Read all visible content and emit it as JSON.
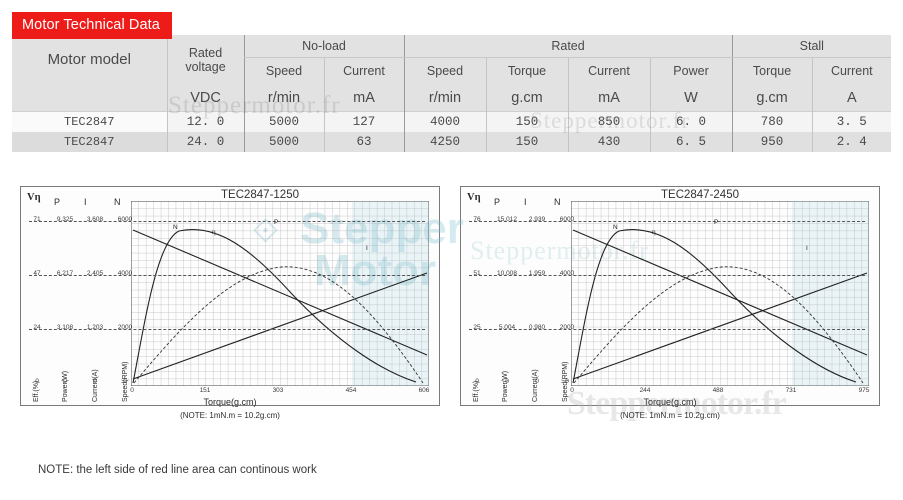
{
  "badge": {
    "label": "Motor Technical Data",
    "color": "#ee1c19"
  },
  "watermark": {
    "text": "Steppermotor.fr",
    "brand_line1": "Stepper",
    "brand_line2": "Motor",
    "logo_glyph": "⟐"
  },
  "table": {
    "model_header": "Motor model",
    "rated_voltage_header_line1": "Rated",
    "rated_voltage_header_line2": "voltage",
    "groups": [
      {
        "label": "No-load",
        "span": 2
      },
      {
        "label": "Rated",
        "span": 4
      },
      {
        "label": "Stall",
        "span": 2
      }
    ],
    "subheaders": [
      "Speed",
      "Current",
      "Speed",
      "Torque",
      "Current",
      "Power",
      "Torque",
      "Current"
    ],
    "units": [
      "VDC",
      "r/min",
      "mA",
      "r/min",
      "g.cm",
      "mA",
      "W",
      "g.cm",
      "A"
    ],
    "rows": [
      {
        "model": "TEC2847",
        "values": [
          "12. 0",
          "5000",
          "127",
          "4000",
          "150",
          "850",
          "6. 0",
          "780",
          "3. 5"
        ]
      },
      {
        "model": "TEC2847",
        "values": [
          "24. 0",
          "5000",
          "63",
          "4250",
          "150",
          "430",
          "6. 5",
          "950",
          "2. 4"
        ]
      }
    ]
  },
  "charts": [
    {
      "title": "TEC2847-1250",
      "axis_headers": [
        "Vη",
        "P",
        "I",
        "N"
      ],
      "vertical_axis_labels": [
        "Eff.(%)",
        "Power(W)",
        "Current(A)",
        "Speed(RPM)"
      ],
      "xaxis_title": "Torque(g.cm)",
      "xaxis_note": "(NOTE: 1mN.m = 10.2g.cm)",
      "curve_labels": [
        "N",
        "η",
        "P",
        "I"
      ],
      "gridrows": [
        {
          "eff": "71",
          "power": "9.325",
          "current": "3.608",
          "speed": "6000"
        },
        {
          "eff": "47",
          "power": "6.217",
          "current": "2.405",
          "speed": "4000"
        },
        {
          "eff": "24",
          "power": "3.108",
          "current": "1.203",
          "speed": "2000"
        },
        {
          "eff": "0",
          "power": "0",
          "current": "0",
          "speed": "0"
        }
      ],
      "xticks": [
        "0",
        "151",
        "303",
        "454",
        "606"
      ]
    },
    {
      "title": "TEC2847-2450",
      "axis_headers": [
        "Vη",
        "P",
        "I",
        "N"
      ],
      "vertical_axis_labels": [
        "Eff.(%)",
        "Power(W)",
        "Current(A)",
        "Speed(RPM)"
      ],
      "xaxis_title": "Torque(g.cm)",
      "xaxis_note": "(NOTE: 1mN.m = 10.2g.cm)",
      "curve_labels": [
        "N",
        "η",
        "P",
        "I"
      ],
      "gridrows": [
        {
          "eff": "76",
          "power": "15.012",
          "current": "2.939",
          "speed": "6000"
        },
        {
          "eff": "51",
          "power": "10.008",
          "current": "1.959",
          "speed": "4000"
        },
        {
          "eff": "25",
          "power": "5.004",
          "current": "0.980",
          "speed": "2000"
        },
        {
          "eff": "0",
          "power": "0",
          "current": "0",
          "speed": "0"
        }
      ],
      "xticks": [
        "0",
        "244",
        "488",
        "731",
        "975"
      ]
    }
  ],
  "footnote": "NOTE: the left side of red line area can continous work",
  "chart_data": [
    {
      "type": "line",
      "title": "TEC2847-1250",
      "xlabel": "Torque(g.cm)",
      "xlim": [
        0,
        680
      ],
      "xticks": [
        0,
        151,
        303,
        454,
        606
      ],
      "grid": true,
      "legend": "inline-curve-labels",
      "axes": [
        {
          "name": "Eff.(%)",
          "symbol": "Vη",
          "ticks": [
            0,
            24,
            47,
            71
          ]
        },
        {
          "name": "Power(W)",
          "symbol": "P",
          "ticks": [
            0,
            3.108,
            6.217,
            9.325
          ]
        },
        {
          "name": "Current(A)",
          "symbol": "I",
          "ticks": [
            0,
            1.203,
            2.405,
            3.608
          ]
        },
        {
          "name": "Speed(RPM)",
          "symbol": "N",
          "ticks": [
            0,
            2000,
            4000,
            6000
          ]
        }
      ],
      "series": [
        {
          "name": "N",
          "axis": "Speed(RPM)",
          "x": [
            0,
            151,
            303,
            454,
            606,
            680
          ],
          "values": [
            5000,
            4300,
            3450,
            2600,
            1750,
            1280
          ]
        },
        {
          "name": "I",
          "axis": "Current(A)",
          "x": [
            0,
            151,
            303,
            454,
            606,
            680
          ],
          "values": [
            0.127,
            0.85,
            1.62,
            2.38,
            3.15,
            3.55
          ]
        },
        {
          "name": "P",
          "axis": "Power(W)",
          "x": [
            0,
            151,
            303,
            454,
            606,
            680
          ],
          "values": [
            0,
            3.1,
            5.4,
            6.2,
            4.9,
            3.1
          ]
        },
        {
          "name": "η",
          "axis": "Eff.(%)",
          "x": [
            0,
            60,
            151,
            303,
            454,
            606,
            680
          ],
          "values": [
            0,
            48,
            55,
            47,
            32,
            14,
            4
          ]
        }
      ]
    },
    {
      "type": "line",
      "title": "TEC2847-2450",
      "xlabel": "Torque(g.cm)",
      "xlim": [
        0,
        1090
      ],
      "xticks": [
        0,
        244,
        488,
        731,
        975
      ],
      "grid": true,
      "legend": "inline-curve-labels",
      "axes": [
        {
          "name": "Eff.(%)",
          "symbol": "Vη",
          "ticks": [
            0,
            25,
            51,
            76
          ]
        },
        {
          "name": "Power(W)",
          "symbol": "P",
          "ticks": [
            0,
            5.004,
            10.008,
            15.012
          ]
        },
        {
          "name": "Current(A)",
          "symbol": "I",
          "ticks": [
            0,
            0.98,
            1.959,
            2.939
          ]
        },
        {
          "name": "Speed(RPM)",
          "symbol": "N",
          "ticks": [
            0,
            2000,
            4000,
            6000
          ]
        }
      ],
      "series": [
        {
          "name": "N",
          "axis": "Speed(RPM)",
          "x": [
            0,
            244,
            488,
            731,
            975,
            1090
          ],
          "values": [
            5000,
            4250,
            3400,
            2550,
            1700,
            1250
          ]
        },
        {
          "name": "I",
          "axis": "Current(A)",
          "x": [
            0,
            244,
            488,
            731,
            975,
            1090
          ],
          "values": [
            0.063,
            0.66,
            1.28,
            1.9,
            2.52,
            2.82
          ]
        },
        {
          "name": "P",
          "axis": "Power(W)",
          "x": [
            0,
            244,
            488,
            731,
            975,
            1090
          ],
          "values": [
            0,
            5.0,
            8.7,
            10.0,
            7.9,
            5.0
          ]
        },
        {
          "name": "η",
          "axis": "Eff.(%)",
          "x": [
            0,
            95,
            244,
            488,
            731,
            975,
            1090
          ],
          "values": [
            0,
            52,
            60,
            51,
            34,
            15,
            4
          ]
        }
      ]
    }
  ]
}
